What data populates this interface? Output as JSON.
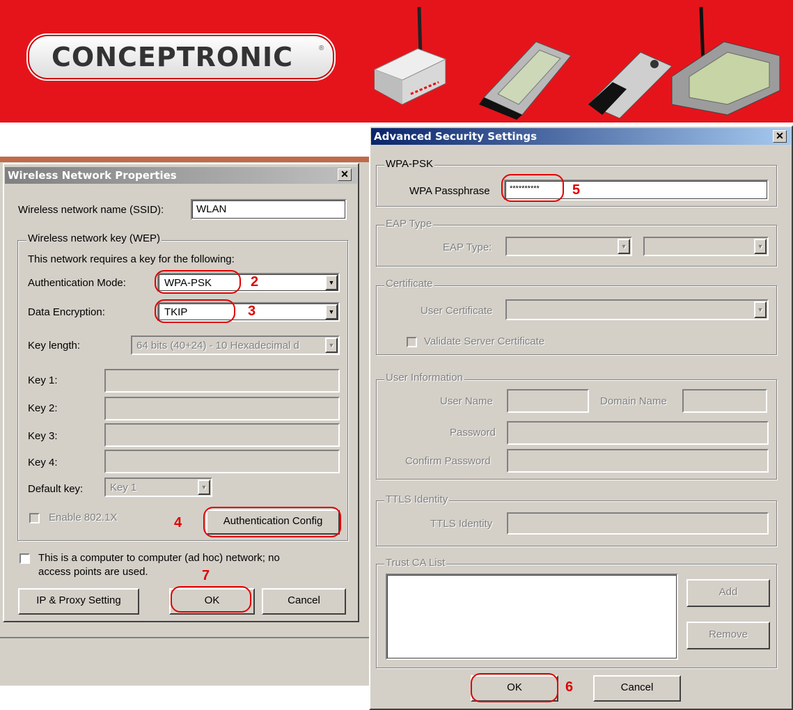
{
  "banner": {
    "logo": "CONCEPTRONIC",
    "colors": {
      "background": "#e5141b"
    }
  },
  "wnp": {
    "title": "Wireless Network Properties",
    "ssid_label": "Wireless network name (SSID):",
    "ssid_value": "WLAN",
    "wep_group": "Wireless network key (WEP)",
    "requires_text": "This network requires a key for the following:",
    "auth_mode_label": "Authentication Mode:",
    "auth_mode_value": "WPA-PSK",
    "encryption_label": "Data Encryption:",
    "encryption_value": "TKIP",
    "key_length_label": "Key length:",
    "key_length_value": "64 bits (40+24) - 10 Hexadecimal d",
    "key1_label": "Key 1:",
    "key2_label": "Key 2:",
    "key3_label": "Key 3:",
    "key4_label": "Key 4:",
    "default_key_label": "Default key:",
    "default_key_value": "Key 1",
    "enable_8021x": "Enable 802.1X",
    "auth_config_button": "Authentication Config",
    "adhoc_text_1": "This is a computer to computer (ad hoc) network; no",
    "adhoc_text_2": "access points are used.",
    "ip_proxy_button": "IP & Proxy Setting",
    "ok_button": "OK",
    "cancel_button": "Cancel"
  },
  "ass": {
    "title": "Advanced Security Settings",
    "wpapsk_group": "WPA-PSK",
    "passphrase_label": "WPA Passphrase",
    "passphrase_value": "**********",
    "eap_group": "EAP Type",
    "eap_type_label": "EAP Type:",
    "cert_group": "Certificate",
    "user_cert_label": "User Certificate",
    "validate_server_cert": "Validate Server Certificate",
    "user_info_group": "User Information",
    "user_name_label": "User Name",
    "domain_name_label": "Domain Name",
    "password_label": "Password",
    "confirm_password_label": "Confirm Password",
    "ttls_group": "TTLS Identity",
    "ttls_label": "TTLS Identity",
    "trust_ca_group": "Trust CA List",
    "add_button": "Add",
    "remove_button": "Remove",
    "ok_button": "OK",
    "cancel_button": "Cancel"
  },
  "annotations": {
    "n2": "2",
    "n3": "3",
    "n4": "4",
    "n5": "5",
    "n6": "6",
    "n7": "7",
    "color": "#e00000"
  },
  "icons": [
    "close-icon",
    "dropdown-arrow-icon",
    "checkbox-icon",
    "router-image",
    "pcmcia-card-image",
    "usb-adapter-image",
    "pci-card-image"
  ]
}
